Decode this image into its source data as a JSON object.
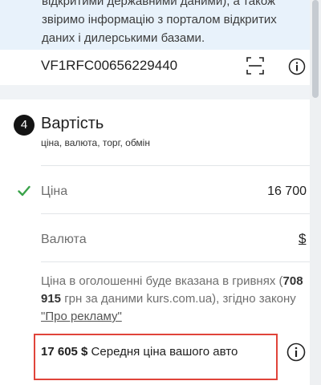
{
  "banner": {
    "text": "відкритими державними даними), а також звіримо інформацію з порталом відкритих даних і дилерськими базами."
  },
  "vin": {
    "value": "VF1RFC00656229440",
    "scan_icon": "scan-icon",
    "info_icon": "info-icon"
  },
  "section": {
    "step": "4",
    "title": "Вартість",
    "subtitle": "ціна, валюта, торг, обмін"
  },
  "price": {
    "label": "Ціна",
    "value": "16 700",
    "status_icon": "check-icon",
    "check_color": "#3aa34a"
  },
  "currency": {
    "label": "Валюта",
    "symbol": "$"
  },
  "note": {
    "prefix": "Ціна в оголошенні буде вказана в гривнях (",
    "amount": "708 915",
    "middle": " грн за даними kurs.com.ua), згідно закону ",
    "link": "\"Про рекламу\""
  },
  "average": {
    "amount": "17 605 $",
    "label": " Середня ціна вашого авто",
    "info_icon": "info-icon",
    "highlight_color": "#e0443a"
  }
}
